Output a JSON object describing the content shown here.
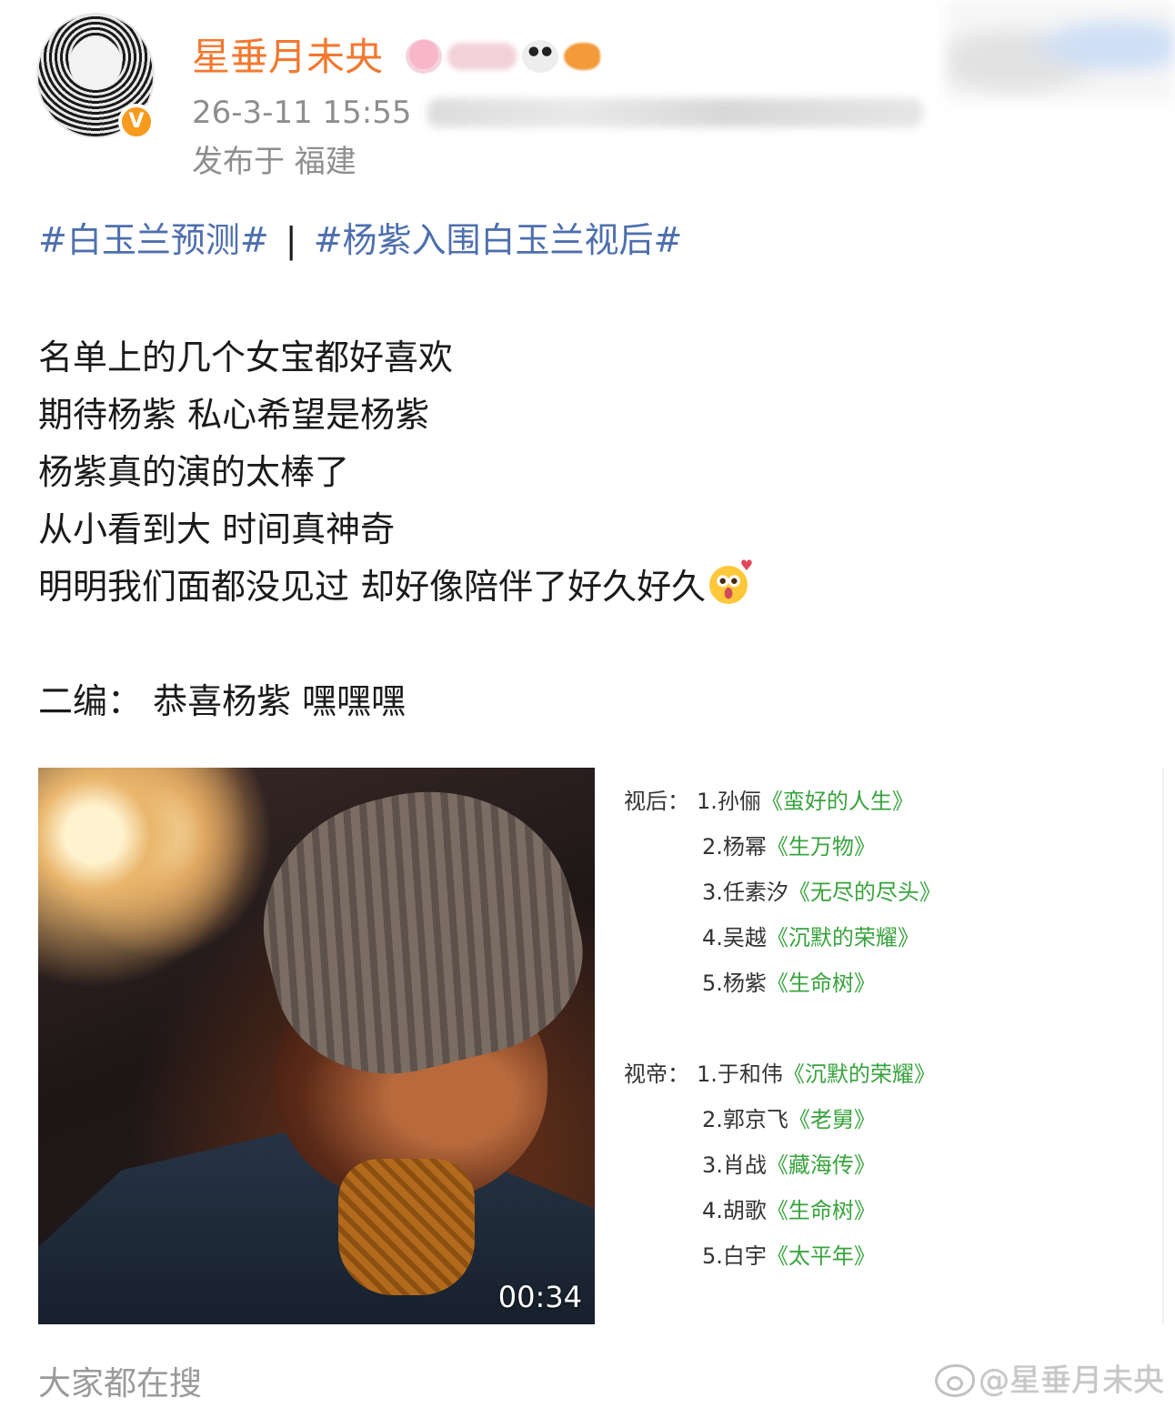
{
  "header": {
    "username": "星垂月未央",
    "verified_mark": "V",
    "timestamp": "26-3-11 15:55",
    "location": "发布于 福建"
  },
  "post": {
    "topics": [
      "#白玉兰预测#",
      "#杨紫入围白玉兰视后#"
    ],
    "topic_separator": "|",
    "lines": [
      "名单上的几个女宝都好喜欢",
      "期待杨紫 私心希望是杨紫",
      "杨紫真的演的太棒了",
      "从小看到大 时间真神奇",
      "明明我们面都没见过 却好像陪伴了好久好久",
      "",
      "二编：  恭喜杨紫 嘿嘿嘿"
    ],
    "emoji_icon": "heart-eyes-face-icon"
  },
  "media": {
    "video": {
      "duration": "00:34"
    },
    "nominees": {
      "actress_label": "视后：",
      "actress": [
        {
          "rank_name": "1.孙俪",
          "work": "《蛮好的人生》"
        },
        {
          "rank_name": "2.杨幂",
          "work": "《生万物》"
        },
        {
          "rank_name": "3.任素汐",
          "work": "《无尽的尽头》"
        },
        {
          "rank_name": "4.吴越",
          "work": "《沉默的荣耀》"
        },
        {
          "rank_name": "5.杨紫",
          "work": "《生命树》"
        }
      ],
      "actor_label": "视帝：",
      "actor": [
        {
          "rank_name": "1.于和伟",
          "work": "《沉默的荣耀》"
        },
        {
          "rank_name": "2.郭京飞",
          "work": "《老舅》"
        },
        {
          "rank_name": "3.肖战",
          "work": "《藏海传》"
        },
        {
          "rank_name": "4.胡歌",
          "work": "《生命树》"
        },
        {
          "rank_name": "5.白宇",
          "work": "《太平年》"
        }
      ]
    }
  },
  "footer": {
    "search_heading": "大家都在搜",
    "watermark": "@星垂月未央",
    "watermark_icon": "weibo-logo-icon"
  },
  "colors": {
    "username": "#f3782f",
    "topic_link": "#4e6fae",
    "meta_text": "#8e8e8e",
    "work_title": "#38a33d",
    "verified_badge": "#f79a1e"
  }
}
